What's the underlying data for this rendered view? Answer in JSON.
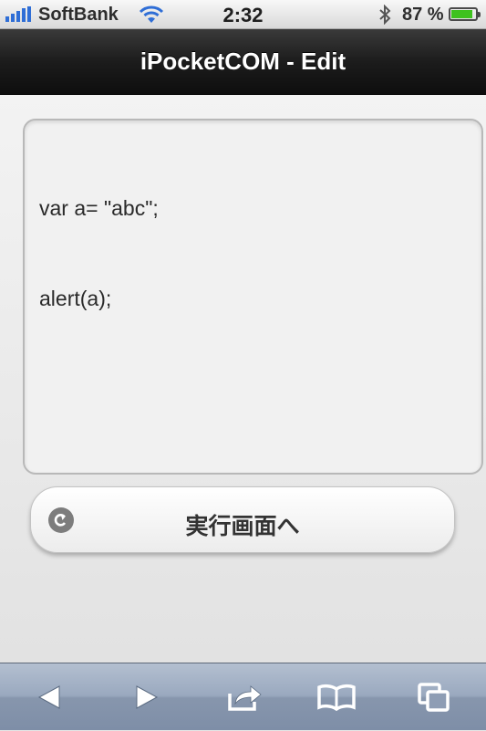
{
  "status": {
    "carrier": "SoftBank",
    "time": "2:32",
    "battery": "87 %",
    "battery_level": 0.87
  },
  "header": {
    "title": "iPocketCOM - Edit"
  },
  "editor": {
    "lines": [
      "var a= \"abc\";",
      "alert(a);"
    ]
  },
  "run_button": {
    "label": "実行画面へ",
    "icon": "refresh-arrow-icon"
  },
  "toolbar": {
    "items": [
      "back-icon",
      "forward-icon",
      "share-icon",
      "bookmarks-icon",
      "pages-icon"
    ]
  },
  "colors": {
    "signal": "#2f6ed6",
    "battery": "#3ec21e",
    "header": "#1c1c1c",
    "toolbar": "#9aa9bf"
  }
}
